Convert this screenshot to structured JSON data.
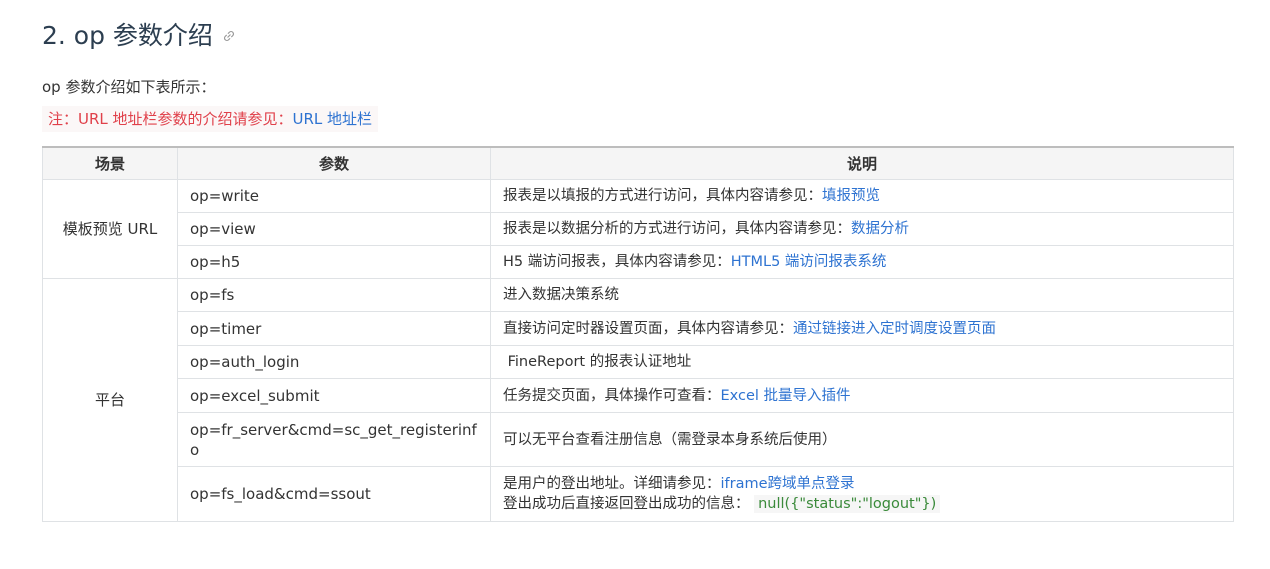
{
  "heading": "2. op 参数介绍",
  "intro": "op 参数介绍如下表所示：",
  "note": {
    "text": "注：URL 地址栏参数的介绍请参见：",
    "link": "URL 地址栏"
  },
  "table": {
    "headers": [
      "场景",
      "参数",
      "说明"
    ],
    "scene_preview": "模板预览 URL",
    "scene_platform": "平台",
    "rows": [
      {
        "param": "op=write",
        "desc": "报表是以填报的方式进行访问，具体内容请参见：",
        "link": "填报预览"
      },
      {
        "param": "op=view",
        "desc": "报表是以数据分析的方式进行访问，具体内容请参见：",
        "link": "数据分析"
      },
      {
        "param": "op=h5",
        "desc": "H5 端访问报表，具体内容请参见：",
        "link": "HTML5 端访问报表系统"
      },
      {
        "param": "op=fs",
        "desc": "进入数据决策系统"
      },
      {
        "param": "op=timer",
        "desc": "直接访问定时器设置页面，具体内容请参见：",
        "link": "通过链接进入定时调度设置页面"
      },
      {
        "param": "op=auth_login",
        "desc": " FineReport 的报表认证地址"
      },
      {
        "param": "op=excel_submit",
        "desc": "任务提交页面，具体操作可查看：",
        "link": "Excel 批量导入插件"
      },
      {
        "param": "op=fr_server&cmd=sc_get_registerinfo",
        "desc": "可以无平台查看注册信息（需登录本身系统后使用）"
      },
      {
        "param": "op=fs_load&cmd=ssout",
        "desc": "是用户的登出地址。详细请参见：",
        "link": "iframe跨域单点登录",
        "desc2": "登出成功后直接返回登出成功的信息：",
        "code": "null({\"status\":\"logout\"})"
      }
    ]
  }
}
